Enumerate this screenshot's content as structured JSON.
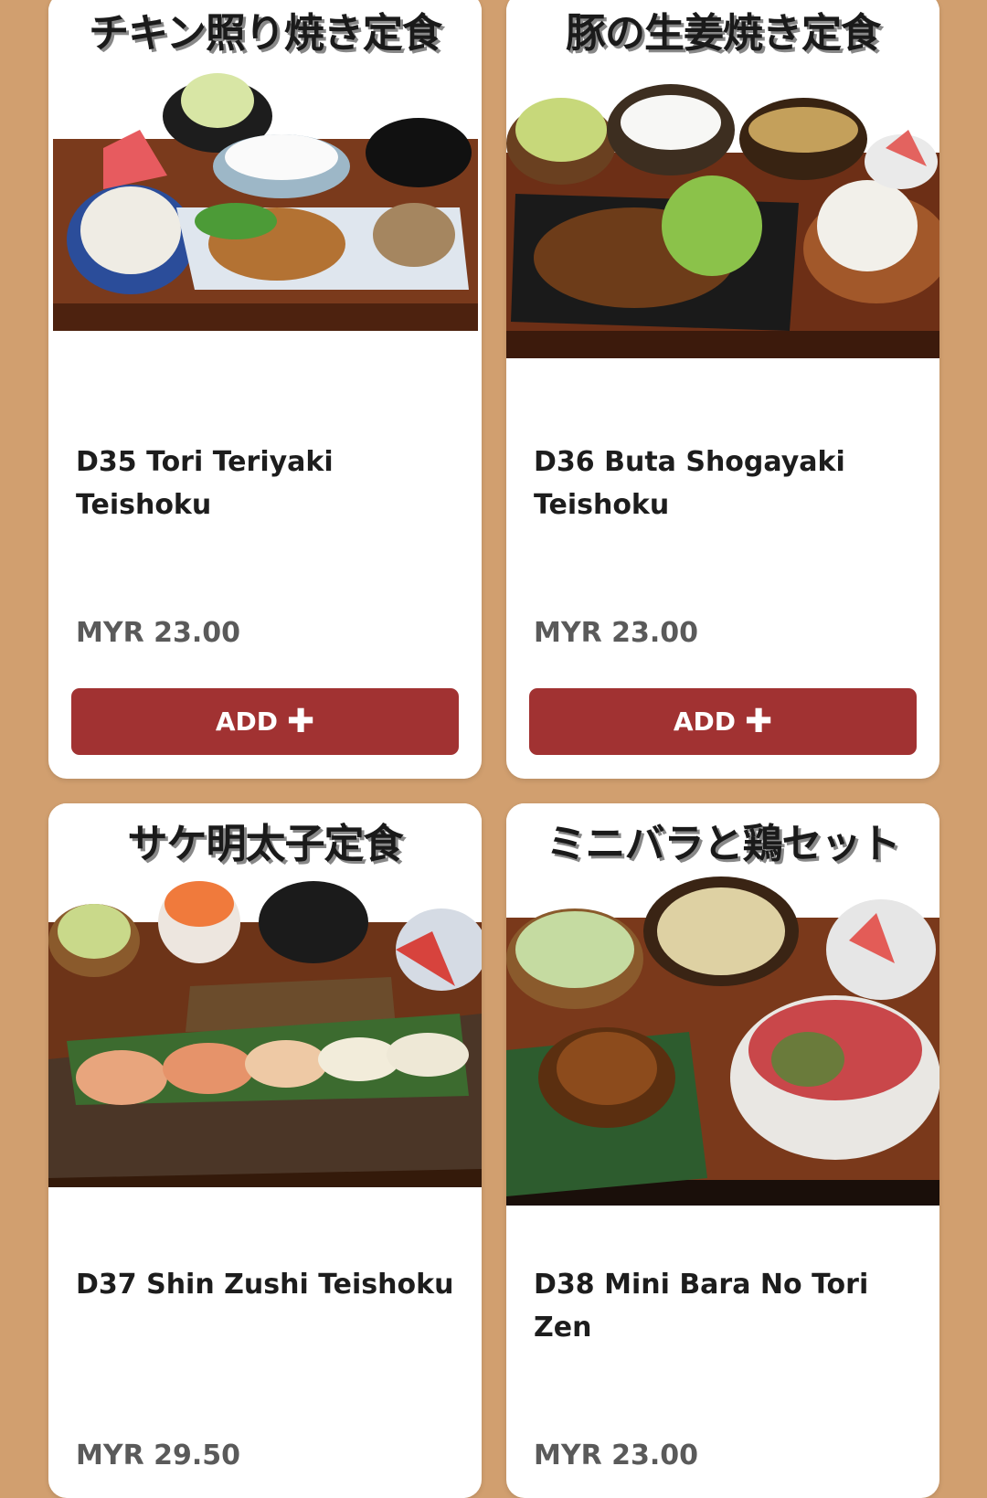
{
  "menu": {
    "items": [
      {
        "jp_title": "チキン照り焼き定食",
        "name": "D35 Tori Teriyaki Teishoku",
        "price": "MYR 23.00",
        "add_label": "ADD",
        "add_icon": "plus-icon"
      },
      {
        "jp_title": "豚の生姜焼き定食",
        "name": "D36 Buta Shogayaki Teishoku",
        "price": "MYR 23.00",
        "add_label": "ADD",
        "add_icon": "plus-icon"
      },
      {
        "jp_title": "サケ明太子定食",
        "name": "D37 Shin Zushi Teishoku",
        "price": "MYR 29.50"
      },
      {
        "jp_title": "ミニバラと鶏セット",
        "name": "D38 Mini Bara No Tori Zen",
        "price": "MYR 23.00"
      }
    ]
  },
  "colors": {
    "background": "#d19f6f",
    "button": "#a13232",
    "card": "#ffffff"
  }
}
